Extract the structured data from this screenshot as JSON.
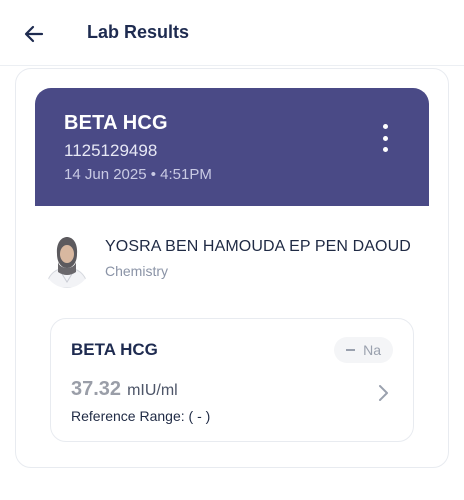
{
  "header": {
    "title": "Lab Results",
    "back_icon": "arrow-left-icon"
  },
  "test": {
    "name": "BETA HCG",
    "id": "1125129498",
    "datetime": "14 Jun 2025 • 4:51PM",
    "menu_icon": "more-vertical-icon",
    "banner_color": "#4a4a86"
  },
  "doctor": {
    "name": "YOSRA BEN HAMOUDA EP PEN DAOUD",
    "specialty": "Chemistry"
  },
  "result": {
    "name": "BETA HCG",
    "status": "Na",
    "value": "37.32",
    "unit": "mIU/ml",
    "reference": "Reference Range: ( - )",
    "chevron_icon": "chevron-right-icon"
  }
}
